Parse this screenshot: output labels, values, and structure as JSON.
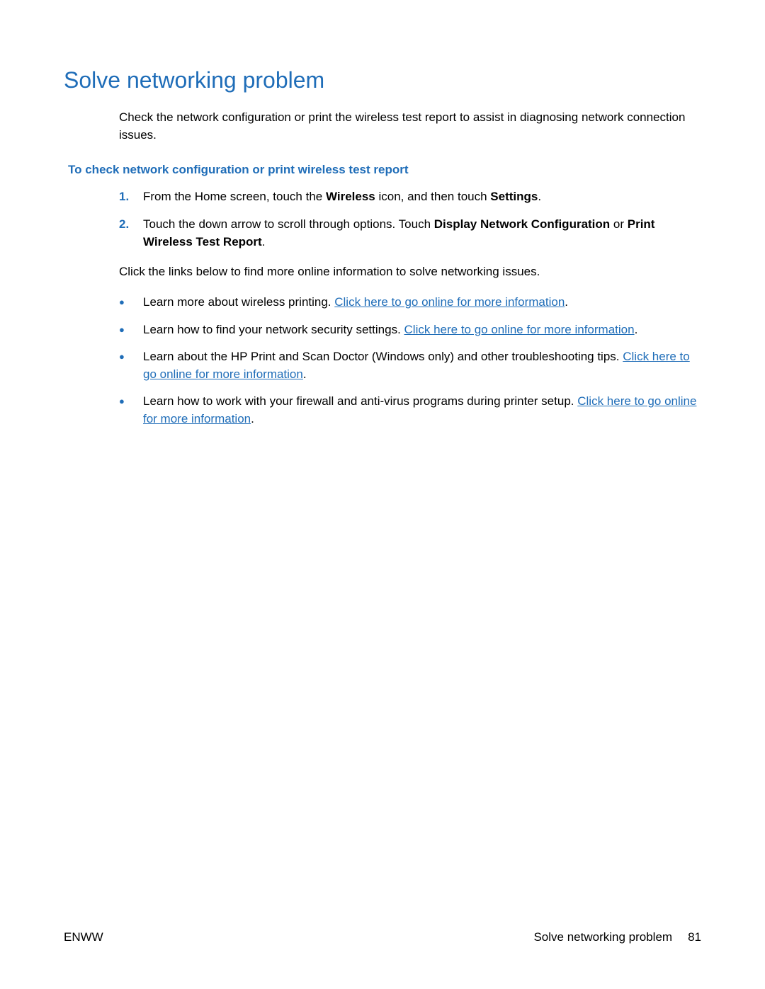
{
  "title": "Solve networking problem",
  "intro": "Check the network configuration or print the wireless test report to assist in diagnosing network connection issues.",
  "subhead": "To check network configuration or print wireless test report",
  "step1": {
    "num": "1.",
    "pre": "From the Home screen, touch the ",
    "b1": "Wireless",
    "mid": " icon, and then touch ",
    "b2": "Settings",
    "post": "."
  },
  "step2": {
    "num": "2.",
    "pre": "Touch the down arrow to scroll through options. Touch ",
    "b1": "Display Network Configuration",
    "mid": " or ",
    "b2": "Print Wireless Test Report",
    "post": "."
  },
  "transition": "Click the links below to find more online information to solve networking issues.",
  "bullets": {
    "b1": {
      "text": "Learn more about wireless printing. ",
      "link": "Click here to go online for more information",
      "post": "."
    },
    "b2": {
      "text": "Learn how to find your network security settings. ",
      "link": "Click here to go online for more information",
      "post": "."
    },
    "b3": {
      "text": "Learn about the HP Print and Scan Doctor (Windows only) and other troubleshooting tips. ",
      "link": "Click here to go online for more information",
      "post": "."
    },
    "b4": {
      "text": "Learn how to work with your firewall and anti-virus programs during printer setup. ",
      "link": "Click here to go online for more information",
      "post": "."
    }
  },
  "footer": {
    "left": "ENWW",
    "right_label": "Solve networking problem",
    "right_page": "81"
  }
}
